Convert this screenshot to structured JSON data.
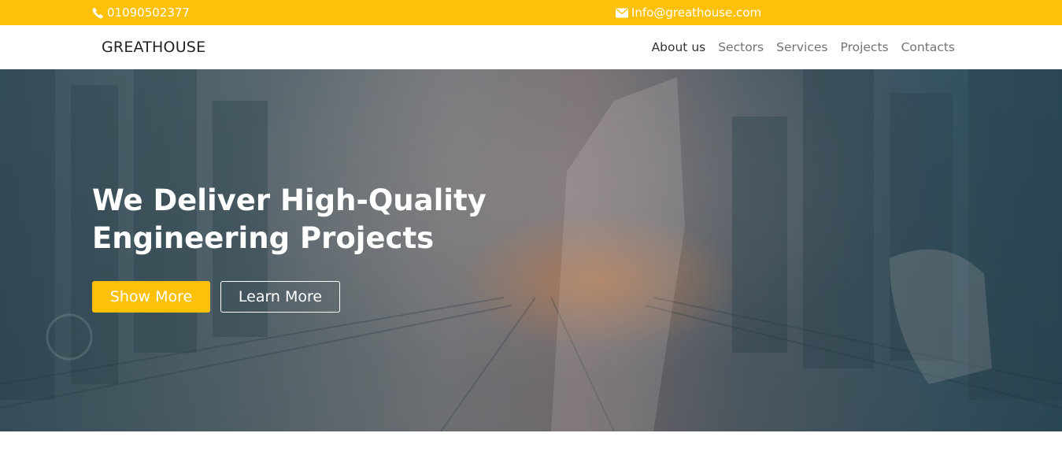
{
  "topbar": {
    "phone": "01090502377",
    "phone_icon": "phone-icon",
    "email": "Info@greathouse.com",
    "email_icon": "envelope-icon"
  },
  "navbar": {
    "brand": "GREATHOUSE",
    "items": [
      {
        "label": "About us",
        "active": true
      },
      {
        "label": "Sectors",
        "active": false
      },
      {
        "label": "Services",
        "active": false
      },
      {
        "label": "Projects",
        "active": false
      },
      {
        "label": "Contacts",
        "active": false
      }
    ]
  },
  "hero": {
    "title": "We Deliver High-Quality Engineering Projects",
    "primary_button": "Show More",
    "secondary_button": "Learn More"
  },
  "colors": {
    "accent": "#ffc107",
    "nav_text": "#737373",
    "nav_active": "#333333"
  }
}
